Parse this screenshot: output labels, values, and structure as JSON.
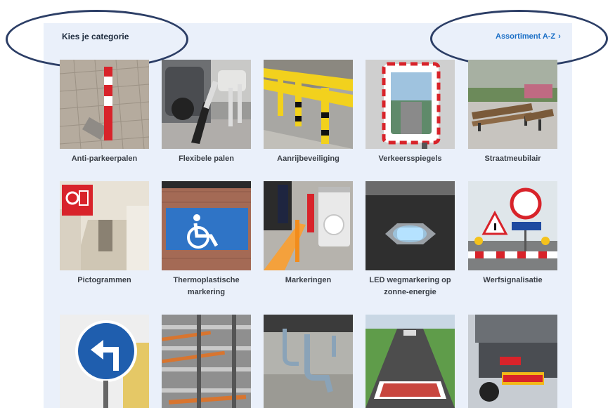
{
  "header": {
    "title": "Kies je categorie",
    "az_link": "Assortiment A-Z",
    "az_chevron": "›"
  },
  "categories": [
    {
      "label": "Anti-parkeerpalen",
      "icon": "anti-parking-post-image"
    },
    {
      "label": "Flexibele palen",
      "icon": "flexible-post-image"
    },
    {
      "label": "Aanrijbeveiliging",
      "icon": "crash-barrier-image"
    },
    {
      "label": "Verkeersspiegels",
      "icon": "traffic-mirror-image"
    },
    {
      "label": "Straatmeubilair",
      "icon": "street-bench-image"
    },
    {
      "label": "Pictogrammen",
      "icon": "fire-hose-pictogram-image"
    },
    {
      "label": "Thermoplastische markering",
      "icon": "wheelchair-marking-image"
    },
    {
      "label": "Markeringen",
      "icon": "marking-paint-image"
    },
    {
      "label": "LED wegmarkering op zonne-energie",
      "icon": "led-road-stud-image"
    },
    {
      "label": "Werfsignalisatie",
      "icon": "roadworks-signs-image"
    },
    {
      "label": "",
      "icon": "turn-left-sign-image"
    },
    {
      "label": "",
      "icon": "pipe-rack-image"
    },
    {
      "label": "",
      "icon": "bike-rack-image"
    },
    {
      "label": "",
      "icon": "speed-bump-road-image"
    },
    {
      "label": "",
      "icon": "truck-rear-image"
    }
  ],
  "colors": {
    "accent": "#1b6fc6",
    "panel": "#eaf0fa",
    "annotation": "#2c3e66"
  }
}
